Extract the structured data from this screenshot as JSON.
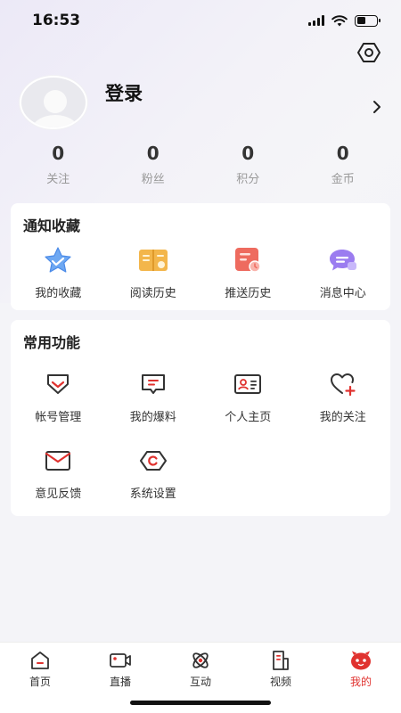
{
  "status_bar": {
    "time": "16:53"
  },
  "profile": {
    "login_label": "登录"
  },
  "stats": [
    {
      "value": "0",
      "label": "关注"
    },
    {
      "value": "0",
      "label": "粉丝"
    },
    {
      "value": "0",
      "label": "积分"
    },
    {
      "value": "0",
      "label": "金币"
    }
  ],
  "notify_section": {
    "title": "通知收藏",
    "items": [
      {
        "label": "我的收藏",
        "icon": "star-icon"
      },
      {
        "label": "阅读历史",
        "icon": "book-icon"
      },
      {
        "label": "推送历史",
        "icon": "push-history-icon"
      },
      {
        "label": "消息中心",
        "icon": "chat-bubble-icon"
      }
    ]
  },
  "common_section": {
    "title": "常用功能",
    "items": [
      {
        "label": "帐号管理",
        "icon": "account-icon"
      },
      {
        "label": "我的爆料",
        "icon": "message-icon"
      },
      {
        "label": "个人主页",
        "icon": "id-card-icon"
      },
      {
        "label": "我的关注",
        "icon": "heart-plus-icon"
      },
      {
        "label": "意见反馈",
        "icon": "envelope-icon"
      },
      {
        "label": "系统设置",
        "icon": "settings-hex-icon"
      }
    ]
  },
  "tabbar": {
    "items": [
      {
        "label": "首页",
        "icon": "home-icon"
      },
      {
        "label": "直播",
        "icon": "camera-icon"
      },
      {
        "label": "互动",
        "icon": "interact-icon"
      },
      {
        "label": "视频",
        "icon": "video-doc-icon"
      },
      {
        "label": "我的",
        "icon": "mine-mascot-icon"
      }
    ],
    "active_index": 4
  },
  "colors": {
    "accent": "#e0322f",
    "background": "#f4f4f8"
  }
}
